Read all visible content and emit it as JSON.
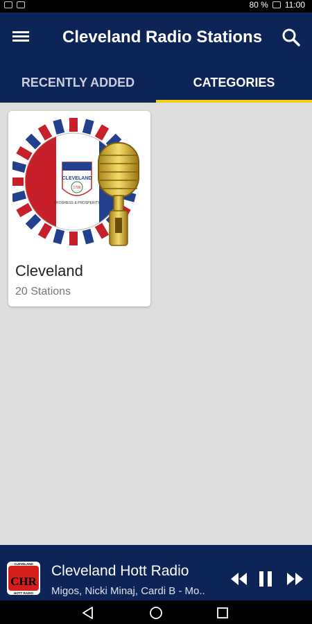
{
  "status_bar": {
    "battery": "80 %",
    "time": "11:00"
  },
  "app_bar": {
    "title": "Cleveland Radio Stations",
    "menu_icon": "menu-icon",
    "search_icon": "search-icon"
  },
  "tabs": [
    {
      "label": "RECENTLY ADDED",
      "selected": false
    },
    {
      "label": "CATEGORIES",
      "selected": true
    }
  ],
  "colors": {
    "primary": "#0d2456",
    "accent": "#f3cd11",
    "background": "#dedede"
  },
  "categories": [
    {
      "title": "Cleveland",
      "subtitle": "20 Stations",
      "seal_text": "CLEVELAND",
      "seal_year": "1796",
      "seal_motto": "PROGRESS & PROSPERITY"
    }
  ],
  "player": {
    "station": "Cleveland Hott Radio",
    "now_playing": "Migos, Nicki Minaj, Cardi B - Mo..",
    "logo_text": "CHR",
    "logo_top_text": "CLEVELAND",
    "logo_bottom_text": "HOTT RADIO"
  }
}
